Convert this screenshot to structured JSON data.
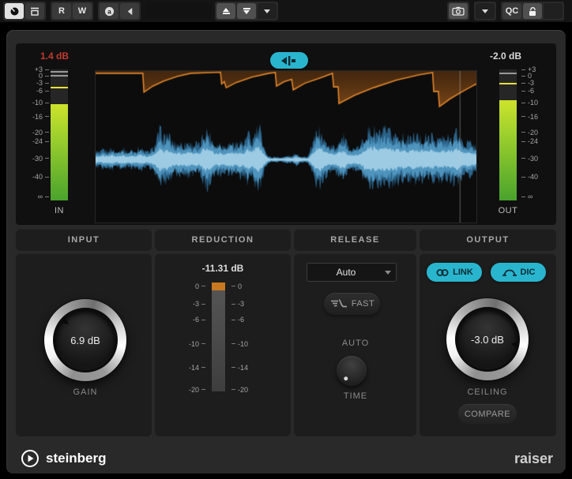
{
  "toolbar": {
    "r_label": "R",
    "w_label": "W",
    "qc_label": "QC",
    "preset_value": ""
  },
  "display": {
    "in_meter": {
      "value": "1.4 dB",
      "label": "IN",
      "scale": [
        "+3",
        "0",
        "-3",
        "-6",
        "-10",
        "-16",
        "-20",
        "-24",
        "-30",
        "-40",
        "∞"
      ],
      "fill_top_frac": 0.267,
      "peak_frac": 0.133,
      "top_lines": [
        0.012,
        0.04
      ]
    },
    "out_meter": {
      "value": "-2.0 dB",
      "label": "OUT",
      "scale": [
        "+3",
        "0",
        "-3",
        "-6",
        "-10",
        "-16",
        "-20",
        "-24",
        "-30",
        "-40",
        "∞"
      ],
      "fill_top_frac": 0.236,
      "peak_frac": 0.103,
      "top_lines": [
        0.024
      ]
    },
    "waveform": {
      "samples": [
        0.3,
        0.22,
        0.34,
        0.27,
        0.38,
        0.25,
        0.31,
        0.36,
        0.24,
        0.33,
        0.28,
        0.4,
        0.3,
        0.26,
        0.34,
        0.55,
        1.0,
        0.72,
        0.88,
        0.6,
        0.52,
        0.58,
        0.48,
        0.62,
        0.5,
        0.56,
        0.47,
        0.9,
        0.97,
        0.7,
        0.5,
        0.55,
        0.46,
        0.52,
        0.58,
        0.5,
        0.62,
        0.55,
        0.88,
        0.6,
        0.95,
        1.0,
        0.45,
        0.12,
        0.08,
        0.1,
        0.07,
        0.09,
        0.13,
        0.1,
        0.22,
        0.12,
        0.09,
        0.11,
        0.45,
        0.85,
        0.95,
        0.65,
        0.5,
        0.42,
        0.48,
        0.7,
        0.75,
        0.4,
        0.35,
        0.38,
        0.42,
        0.8,
        0.95,
        1.0,
        0.92,
        0.88,
        0.95,
        0.9,
        0.85,
        0.88,
        0.72,
        0.78,
        0.68,
        0.75,
        0.8,
        0.7,
        0.76,
        0.72,
        0.78,
        0.68,
        0.74,
        0.7,
        0.72,
        0.75,
        0.95,
        0.7,
        0.55,
        0.6,
        0.5,
        0.45
      ],
      "envelope": [
        [
          0,
          0.015
        ],
        [
          0.124,
          0.015
        ],
        [
          0.127,
          0.14
        ],
        [
          0.15,
          0.1
        ],
        [
          0.18,
          0.065
        ],
        [
          0.215,
          0.035
        ],
        [
          0.25,
          0.015
        ],
        [
          0.328,
          0.008
        ],
        [
          0.331,
          0.085
        ],
        [
          0.338,
          0.07
        ],
        [
          0.343,
          0.11
        ],
        [
          0.37,
          0.075
        ],
        [
          0.41,
          0.04
        ],
        [
          0.455,
          0.015
        ],
        [
          0.472,
          0.01
        ],
        [
          0.475,
          0.1
        ],
        [
          0.495,
          0.07
        ],
        [
          0.515,
          0.055
        ],
        [
          0.519,
          0.125
        ],
        [
          0.55,
          0.08
        ],
        [
          0.59,
          0.045
        ],
        [
          0.622,
          0.015
        ],
        [
          0.625,
          0.105
        ],
        [
          0.637,
          0.105
        ],
        [
          0.639,
          0.215
        ],
        [
          0.68,
          0.16
        ],
        [
          0.73,
          0.11
        ],
        [
          0.79,
          0.06
        ],
        [
          0.85,
          0.025
        ],
        [
          0.885,
          0.01
        ],
        [
          0.888,
          0.135
        ],
        [
          0.9,
          0.135
        ],
        [
          0.903,
          0.235
        ],
        [
          0.93,
          0.185
        ],
        [
          0.96,
          0.14
        ],
        [
          0.985,
          0.105
        ],
        [
          1.0,
          0.085
        ]
      ],
      "playhead_frac": 0.957
    }
  },
  "sections": {
    "input": {
      "title": "INPUT",
      "value": "6.9 dB",
      "label": "GAIN",
      "knob_angle": -47
    },
    "reduction": {
      "title": "REDUCTION",
      "value": "-11.31 dB",
      "scale": [
        "0",
        "-3",
        "-6",
        "-10",
        "-14",
        "-20"
      ],
      "gr_frac": 0.075
    },
    "release": {
      "title": "RELEASE",
      "mode_value": "Auto",
      "fast_label": "FAST",
      "auto_label": "AUTO",
      "time_label": "TIME",
      "time_knob_angle": -140
    },
    "output": {
      "title": "OUTPUT",
      "link_label": "LINK",
      "dic_label": "DIC",
      "value": "-3.0 dB",
      "label": "CEILING",
      "compare_label": "COMPARE",
      "knob_angle": 100
    }
  },
  "footer": {
    "brand": "steinberg",
    "plugin_name": "raiser"
  },
  "colors": {
    "accent_cyan": "#2ab5ce",
    "in_value_red": "#c23b30",
    "out_value_white": "#d8d8d8",
    "envelope_orange": "#e0862b",
    "reduction_orange": "#c87820",
    "waveform_blue": "#4e94bd"
  }
}
